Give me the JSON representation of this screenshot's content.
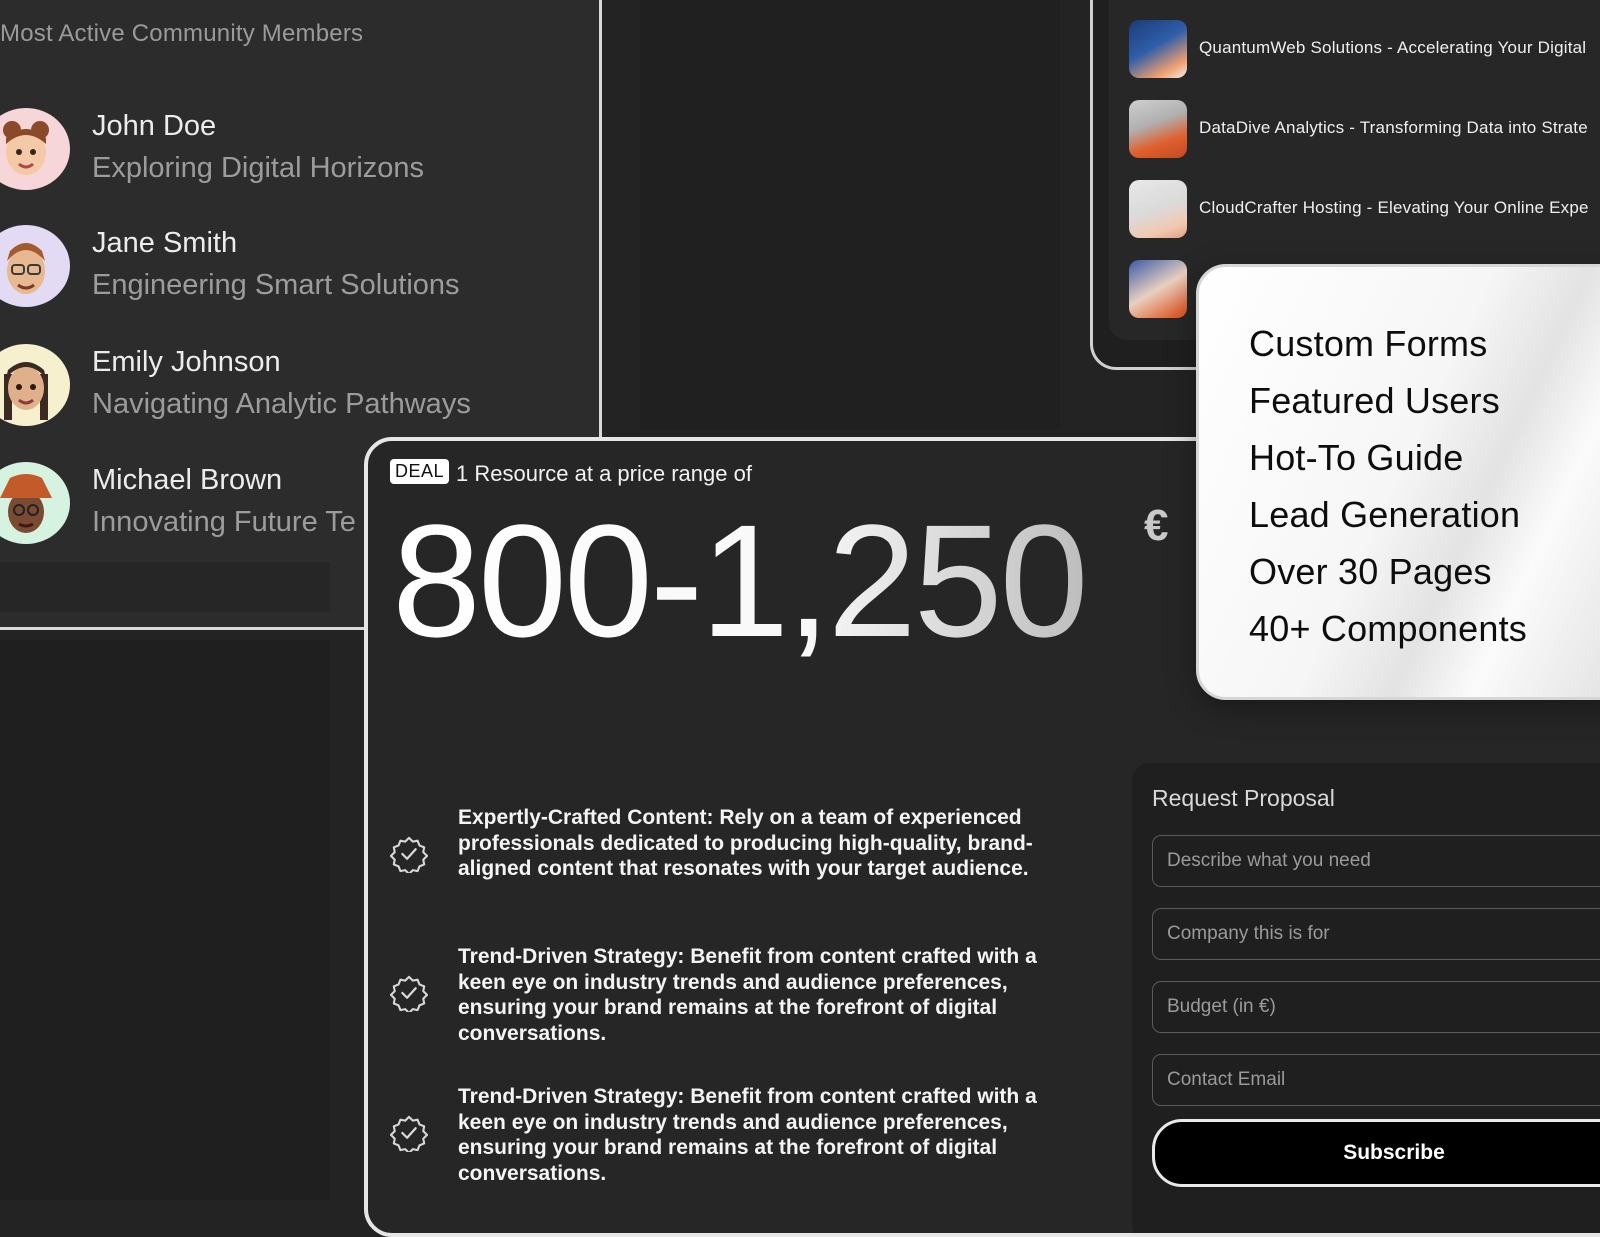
{
  "members": {
    "title": "Most Active Community Members",
    "items": [
      {
        "name": "John Doe",
        "subtitle": "Exploring Digital Horizons",
        "avatar": "girl-buns-avatar"
      },
      {
        "name": "Jane Smith",
        "subtitle": "Engineering Smart Solutions",
        "avatar": "man-glasses-avatar"
      },
      {
        "name": "Emily Johnson",
        "subtitle": "Navigating Analytic Pathways",
        "avatar": "braids-avatar"
      },
      {
        "name": "Michael Brown",
        "subtitle": "Innovating Future Te",
        "avatar": "bucket-hat-avatar"
      }
    ]
  },
  "links": {
    "items": [
      {
        "text": "QuantumWeb Solutions - Accelerating Your Digital"
      },
      {
        "text": "DataDive Analytics - Transforming Data into Strate"
      },
      {
        "text": "CloudCrafter Hosting - Elevating Your Online Expe"
      },
      {
        "text": ""
      }
    ]
  },
  "deal": {
    "tag": "DEAL",
    "lead": "1 Resource at a price range of",
    "price": "800-1,250",
    "currency": "€",
    "features": [
      "Expertly-Crafted Content: Rely on a team of experienced professionals dedicated to producing high-quality, brand-aligned content that resonates with your target audience.",
      "Trend-Driven Strategy: Benefit from content crafted with a keen eye on industry trends and audience preferences, ensuring your brand remains at the forefront of digital conversations.",
      "Trend-Driven Strategy: Benefit from content crafted with a keen eye on industry trends and audience preferences, ensuring your brand remains at the forefront of digital conversations."
    ]
  },
  "proposal": {
    "title": "Request Proposal",
    "fields": [
      {
        "placeholder": "Describe what you need"
      },
      {
        "placeholder": "Company this is for"
      },
      {
        "placeholder": "Budget (in €)"
      },
      {
        "placeholder": "Contact Email"
      }
    ],
    "submit": "Subscribe"
  },
  "features_list": {
    "items": [
      "Custom Forms",
      "Featured Users",
      "Hot-To Guide",
      "Lead Generation",
      "Over 30 Pages",
      "40+ Components"
    ]
  }
}
